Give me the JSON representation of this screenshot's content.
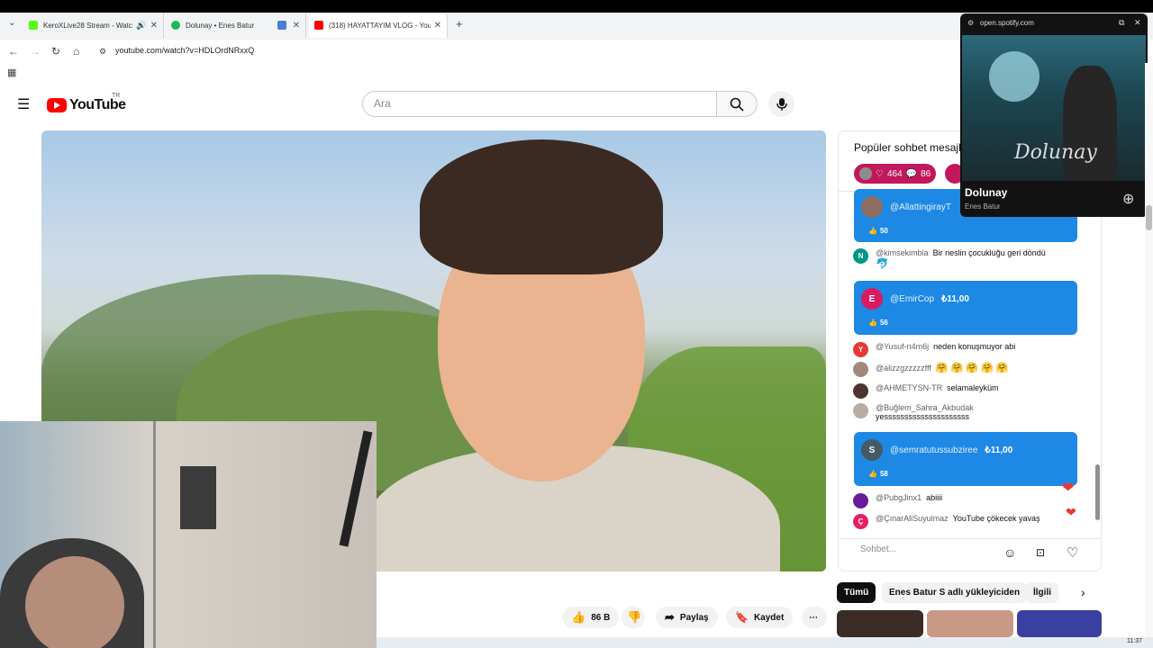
{
  "browser": {
    "tabs": [
      {
        "label": "KeroXLive28 Stream - Watc",
        "color": "#53fc18"
      },
      {
        "label": "Dolunay • Enes Batur",
        "color": "#1db954"
      },
      {
        "label": "",
        "color": "#4a7bd8"
      },
      {
        "label": "(318) HAYATTAYIM VLOG - You",
        "color": "#ff0000"
      }
    ],
    "new_tab": "+",
    "url": "youtube.com/watch?v=HDLOrdNRxxQ"
  },
  "youtube": {
    "logo_text": "YouTube",
    "country": "TR",
    "search_placeholder": "Ara"
  },
  "actions": {
    "likes": "86 B",
    "share": "Paylaş",
    "save": "Kaydet",
    "more": "⋯"
  },
  "chat": {
    "title": "Popüler sohbet mesajl",
    "pill_likes": "464",
    "pill_comments": "86",
    "messages": [
      {
        "type": "superchat",
        "author": "@AllattingirayT",
        "amount": "",
        "likes": "50",
        "avatar_letter": "",
        "avatar_color": "#8d6e63"
      },
      {
        "type": "text",
        "author": "@kimsekimbia",
        "text": "Bir neslin çocukluğu geri döndü",
        "avatar_letter": "N",
        "avatar_color": "#009688",
        "emoji": "🐬"
      },
      {
        "type": "superchat",
        "author": "@EmirCop",
        "amount": "₺11,00",
        "likes": "56",
        "avatar_letter": "E",
        "avatar_color": "#d81b60"
      },
      {
        "type": "text",
        "author": "@Yusuf-n4m6j",
        "text": "neden konuşmuyor abi",
        "avatar_letter": "Y",
        "avatar_color": "#e53935"
      },
      {
        "type": "text",
        "author": "@alizzgzzzzzfff",
        "text": "🤗 🤗 🤗 🤗 🤗",
        "avatar_letter": "",
        "avatar_color": "#a1887f"
      },
      {
        "type": "text",
        "author": "@AHMETYSN-TR",
        "text": "selamaleyküm",
        "avatar_letter": "",
        "avatar_color": "#4e342e"
      },
      {
        "type": "text",
        "author": "@Buğlem_Sahra_Akbudak",
        "text": "yesssssssssssssssssssss",
        "avatar_letter": "",
        "avatar_color": "#bcaaa4"
      },
      {
        "type": "superchat",
        "author": "@semratutussubziree",
        "amount": "₺11,00",
        "likes": "58",
        "avatar_letter": "S",
        "avatar_color": "#455a64"
      },
      {
        "type": "text",
        "author": "@PubgJinx1",
        "text": "abiiii",
        "avatar_letter": "",
        "avatar_color": "#6a1b9a"
      },
      {
        "type": "text",
        "author": "@ÇınarAliSuyulmaz",
        "text": "YouTube çökecek yavaş",
        "avatar_letter": "Ç",
        "avatar_color": "#e91e63"
      }
    ],
    "input_placeholder": "Sohbet..."
  },
  "chips": [
    "Tümü",
    "Enes Batur S adlı yükleyiciden",
    "İlgili"
  ],
  "spotify": {
    "domain": "open.spotify.com",
    "title": "Dolunay",
    "artist": "Enes Batur",
    "art_text": "Dolunay"
  },
  "clock": "11:37"
}
